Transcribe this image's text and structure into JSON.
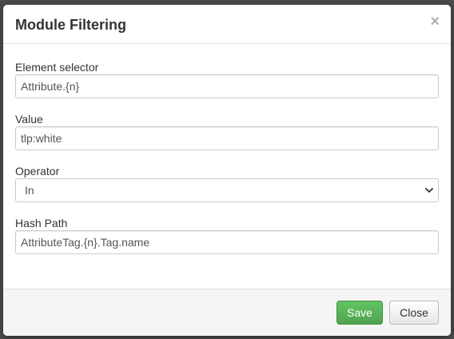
{
  "modal": {
    "title": "Module Filtering",
    "close_glyph": "×"
  },
  "form": {
    "element_selector": {
      "label": "Element selector",
      "value": "Attribute.{n}"
    },
    "value": {
      "label": "Value",
      "value": "tlp:white"
    },
    "operator": {
      "label": "Operator",
      "selected": "In"
    },
    "hash_path": {
      "label": "Hash Path",
      "value": "AttributeTag.{n}.Tag.name"
    }
  },
  "footer": {
    "save_label": "Save",
    "close_label": "Close"
  },
  "colors": {
    "save_button": "#5bb75b",
    "footer_bg": "#f5f5f5",
    "backdrop": "#4a4a4a"
  }
}
